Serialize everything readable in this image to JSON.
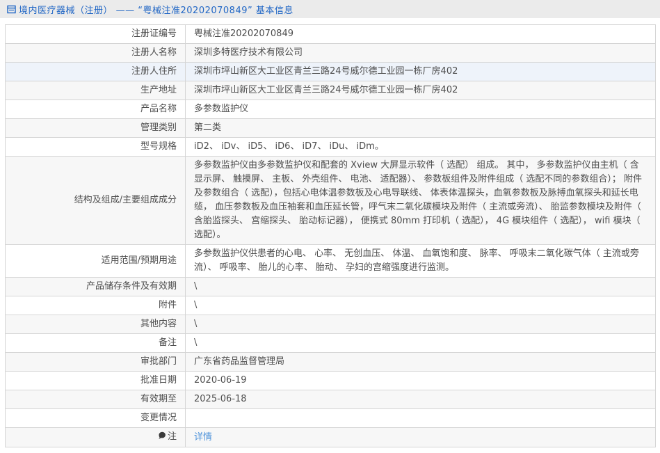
{
  "header": {
    "icon": "document-icon",
    "title": "境内医疗器械（注册） —— “粤械注准20202070849” 基本信息"
  },
  "colors": {
    "header_bg": "#ebebeb",
    "header_text": "#2066c5",
    "row_alt_bg": "#f7f7f7",
    "row_highlight_bg": "#eef3fa",
    "border": "#d5d5d5",
    "text": "#4d4d4d",
    "link": "#4a90d9"
  },
  "table": {
    "rows": [
      {
        "label": "注册证编号",
        "value": "粤械注准20202070849"
      },
      {
        "label": "注册人名称",
        "value": "深圳多特医疗技术有限公司"
      },
      {
        "label": "注册人住所",
        "value": "深圳市坪山新区大工业区青兰三路24号威尔德工业园一栋厂房402",
        "highlight": true
      },
      {
        "label": "生产地址",
        "value": "深圳市坪山新区大工业区青兰三路24号威尔德工业园一栋厂房402"
      },
      {
        "label": "产品名称",
        "value": "多参数监护仪"
      },
      {
        "label": "管理类别",
        "value": "第二类"
      },
      {
        "label": "型号规格",
        "value": "iD2、 iDv、 iD5、 iD6、 iD7、 iDu、 iDm。"
      },
      {
        "label": "结构及组成/主要组成成分",
        "value": "多参数监护仪由多参数监护仪和配套的 Xview 大屏显示软件（ 选配） 组成。 其中， 多参数监护仪由主机（ 含显示屏、 触摸屏、 主板、 外壳组件、 电池、 适配器）、 参数板组件及附件组成（ 选配不同的参数组合）； 附件及参数组合（ 选配），包括心电体温参数板及心电导联线、 体表体温探头，血氧参数板及脉搏血氧探头和延长电缆， 血压参数板及血压袖套和血压延长管，呼气末二氧化碳模块及附件（ 主流或旁流）、 胎监参数模块及附件（ 含胎监探头、 宫缩探头、 胎动标记器）， 便携式 80mm 打印机（ 选配）， 4G 模块组件（ 选配）， wifi 模块（ 选配）。"
      },
      {
        "label": "适用范围/预期用途",
        "value": "多参数监护仪供患者的心电、 心率、 无创血压、 体温、 血氧饱和度、 脉率、 呼吸末二氧化碳气体（ 主流或旁流）、 呼吸率、 胎儿的心率、 胎动、 孕妇的宫缩强度进行监测。"
      },
      {
        "label": "产品储存条件及有效期",
        "value": "\\"
      },
      {
        "label": "附件",
        "value": "\\"
      },
      {
        "label": "其他内容",
        "value": "\\"
      },
      {
        "label": "备注",
        "value": "\\"
      },
      {
        "label": "审批部门",
        "value": "广东省药品监督管理局"
      },
      {
        "label": "批准日期",
        "value": "2020-06-19"
      },
      {
        "label": "有效期至",
        "value": "2025-06-18"
      },
      {
        "label": "变更情况",
        "value": ""
      },
      {
        "label": "注",
        "value": "详情",
        "link": true,
        "label_icon": "note-balloon-icon"
      }
    ]
  }
}
